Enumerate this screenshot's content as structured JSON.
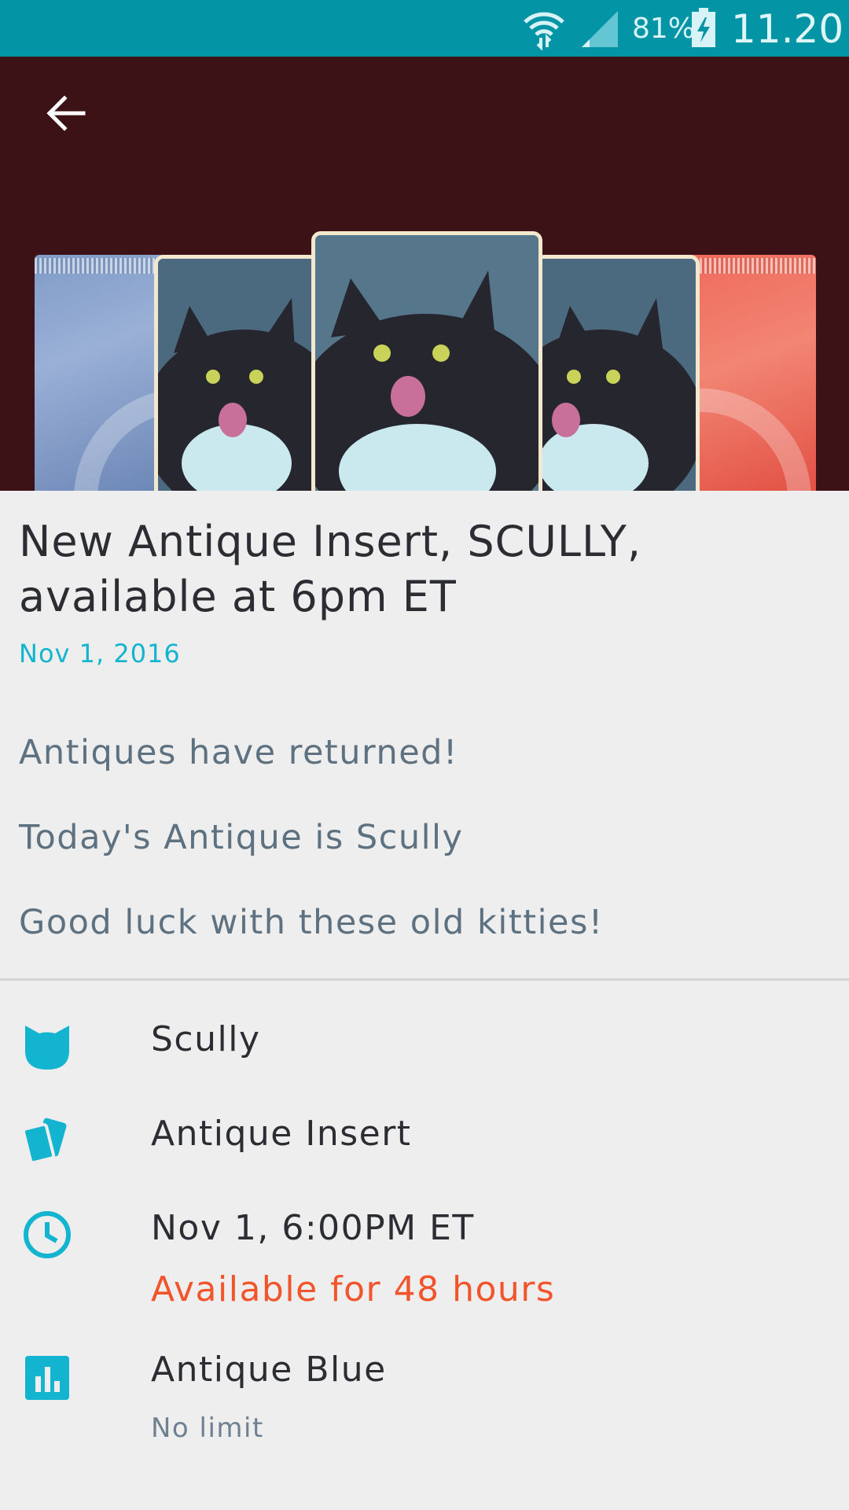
{
  "status_bar": {
    "battery_percent": "81%",
    "time": "11.20",
    "icons": [
      "wifi-icon",
      "cell-signal-icon",
      "battery-charging-icon"
    ]
  },
  "header": {
    "back_icon": "arrow-back-icon",
    "image": "cat-card-pack-artwork"
  },
  "article": {
    "title": "New Antique Insert, SCULLY, available at 6pm ET",
    "date": "Nov 1, 2016",
    "paragraphs": [
      "Antiques have returned!",
      "Today's Antique is Scully",
      "Good luck with these old kitties!"
    ]
  },
  "details": {
    "cat": {
      "icon": "cat-head-icon",
      "label": "Scully"
    },
    "type": {
      "icon": "cards-icon",
      "label": "Antique Insert"
    },
    "time": {
      "icon": "clock-icon",
      "label": "Nov 1, 6:00PM ET",
      "sub": "Available for 48 hours"
    },
    "rarity": {
      "icon": "bar-chart-icon",
      "label": "Antique Blue",
      "sub": "No limit"
    }
  },
  "colors": {
    "status_bar": "#0394a6",
    "hero_background": "#3c1216",
    "accent": "#12b4cf",
    "availability": "#f2552c"
  }
}
